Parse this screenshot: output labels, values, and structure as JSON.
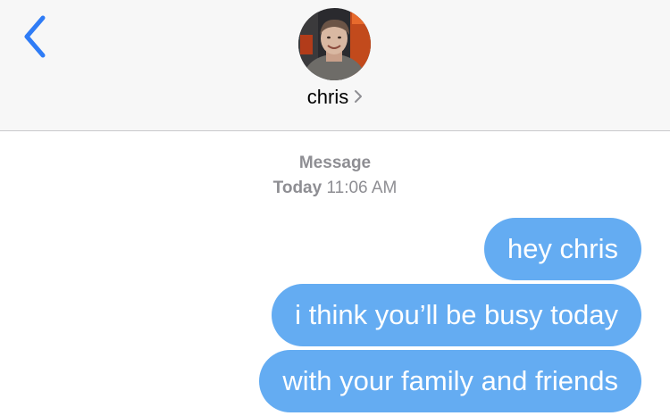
{
  "header": {
    "contact_name": "chris",
    "avatar_icon": "contact-photo",
    "back_icon": "chevron-left-icon",
    "accent_color": "#2f7cf6"
  },
  "timestamp": {
    "service": "Message",
    "day": "Today",
    "time": "11:06 AM"
  },
  "messages": [
    {
      "sender": "me",
      "text": "hey chris"
    },
    {
      "sender": "me",
      "text": "i think you’ll be busy today"
    },
    {
      "sender": "me",
      "text": "with your family and friends"
    }
  ],
  "colors": {
    "bubble_sent": "#64acf2",
    "header_bg": "#f7f7f7",
    "timestamp_text": "#8e8e93"
  }
}
